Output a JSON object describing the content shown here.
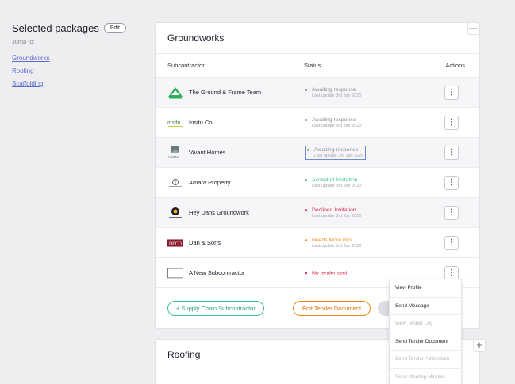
{
  "sidebar": {
    "title": "Selected packages",
    "edit_label": "Edit",
    "jump_label": "Jump to:",
    "links": [
      "Groundworks",
      "Roofing",
      "Scaffolding"
    ]
  },
  "groundworks": {
    "title": "Groundworks",
    "collapse_icon": "—",
    "headers": {
      "subcontractor": "Subcontractor",
      "status": "Status",
      "actions": "Actions"
    },
    "rows": [
      {
        "name": "The Ground & Frame Team",
        "status": "Awaiting response",
        "updated": "Last update 3rd Jan 2020",
        "status_color": "#8b8b96"
      },
      {
        "name": "Insitu Co",
        "status": "Awaiting response",
        "updated": "Last update 3rd Jan 2020",
        "status_color": "#8b8b96"
      },
      {
        "name": "Vivant Homes",
        "status": "Awaiting response",
        "updated": "Last update 3rd Jan 2020",
        "status_color": "#8b8b96"
      },
      {
        "name": "Amara Property",
        "status": "Accepted Invitation",
        "updated": "Last update 3rd Jan 2020",
        "status_color": "#3cbf91"
      },
      {
        "name": "Hey Dans Groundwork",
        "status": "Declined Invitation",
        "updated": "Last update 3rd Jan 2020",
        "status_color": "#e0284e"
      },
      {
        "name": "Dan & Sons",
        "status": "Needs More info",
        "updated": "Last update 3rd Jan 2020",
        "status_color": "#f08a1a"
      },
      {
        "name": "A New Subcontractor",
        "status": "No tender sent",
        "updated": "",
        "status_color": "#e0284e"
      }
    ],
    "kebab_glyph": "⋮",
    "supply_chain_label": "+ Supply Chain Subcontractor",
    "edit_tender_label": "Edit Tender Document"
  },
  "roofing": {
    "title": "Roofing",
    "expand_icon": "+"
  },
  "logos": {
    "r1_text": "GROUND & FRAME",
    "r2_text": "insitu",
    "r3_text": "VIVANT",
    "r6_text": "DECO"
  },
  "context_menu": {
    "items": [
      {
        "label": "View Profile",
        "disabled": false
      },
      {
        "label": "Send Message",
        "disabled": false
      },
      {
        "label": "View Tender Log",
        "disabled": true
      },
      {
        "label": "Send Tender Document",
        "disabled": false
      },
      {
        "label": "Send Tender Addendum",
        "disabled": true
      },
      {
        "label": "Send Meeting Minutes",
        "disabled": true
      }
    ]
  },
  "colors": {
    "accent_green": "#3cbf91",
    "accent_orange": "#f08a1a",
    "link_blue": "#5b6cc9",
    "declined_red": "#e0284e"
  }
}
